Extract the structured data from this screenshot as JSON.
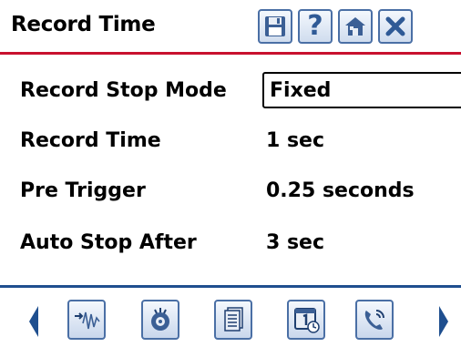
{
  "header": {
    "title": "Record Time",
    "buttons": [
      {
        "name": "save-icon"
      },
      {
        "name": "help-icon",
        "glyph": "?"
      },
      {
        "name": "home-icon"
      },
      {
        "name": "close-icon"
      }
    ]
  },
  "fields": [
    {
      "label": "Record Stop Mode",
      "value": "Fixed",
      "type": "select"
    },
    {
      "label": "Record Time",
      "value": "1 sec"
    },
    {
      "label": "Pre Trigger",
      "value": "0.25 seconds"
    },
    {
      "label": "Auto Stop After",
      "value": "3 sec"
    }
  ],
  "footer": {
    "buttons": [
      {
        "name": "waveform-input-icon"
      },
      {
        "name": "trigger-target-icon"
      },
      {
        "name": "documents-icon"
      },
      {
        "name": "calendar-clock-icon"
      },
      {
        "name": "phone-signal-icon"
      }
    ],
    "prev": "previous-page-icon",
    "next": "next-page-icon"
  },
  "colors": {
    "header_rule": "#c8102e",
    "footer_rule": "#1f4f8f",
    "icon_border": "#4a6fa5",
    "arrow": "#1f4f8f"
  }
}
